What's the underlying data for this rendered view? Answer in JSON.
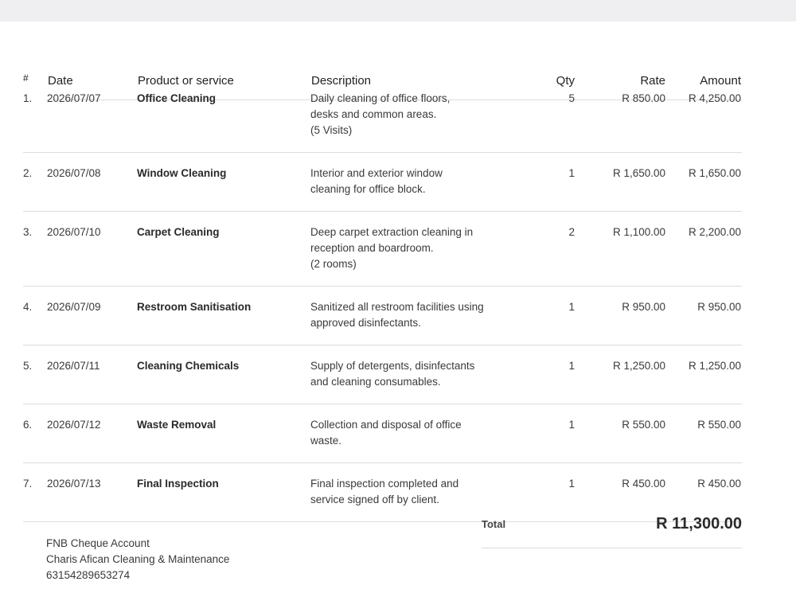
{
  "headers": {
    "number": "#",
    "date": "Date",
    "product": "Product or service",
    "description": "Description",
    "qty": "Qty",
    "rate": "Rate",
    "amount": "Amount"
  },
  "rows": [
    {
      "number": "1.",
      "date": "2026/07/07",
      "product": "Office Cleaning",
      "description": [
        "Daily cleaning of office floors,",
        "desks and common areas.",
        "(5 Visits)"
      ],
      "qty": "5",
      "rate": "R 850.00",
      "amount": "R 4,250.00"
    },
    {
      "number": "2.",
      "date": "2026/07/08",
      "product": "Window Cleaning",
      "description": [
        "Interior and exterior window",
        "cleaning for office block."
      ],
      "qty": "1",
      "rate": "R 1,650.00",
      "amount": "R 1,650.00"
    },
    {
      "number": "3.",
      "date": "2026/07/10",
      "product": "Carpet Cleaning",
      "description": [
        "Deep carpet extraction cleaning in",
        "reception and boardroom.",
        "(2 rooms)"
      ],
      "qty": "2",
      "rate": "R 1,100.00",
      "amount": "R 2,200.00"
    },
    {
      "number": "4.",
      "date": "2026/07/09",
      "product": "Restroom Sanitisation",
      "description": [
        "Sanitized all restroom facilities using",
        "approved disinfectants."
      ],
      "qty": "1",
      "rate": "R 950.00",
      "amount": "R 950.00"
    },
    {
      "number": "5.",
      "date": "2026/07/11",
      "product": "Cleaning Chemicals",
      "description": [
        "Supply of detergents, disinfectants",
        "and cleaning consumables."
      ],
      "qty": "1",
      "rate": "R 1,250.00",
      "amount": "R 1,250.00"
    },
    {
      "number": "6.",
      "date": "2026/07/12",
      "product": "Waste Removal",
      "description": [
        "Collection and disposal of office",
        "waste."
      ],
      "qty": "1",
      "rate": "R 550.00",
      "amount": "R 550.00"
    },
    {
      "number": "7.",
      "date": "2026/07/13",
      "product": "Final Inspection",
      "description": [
        "Final inspection completed and",
        "service signed off by client."
      ],
      "qty": "1",
      "rate": "R 450.00",
      "amount": "R 450.00"
    }
  ],
  "bank": {
    "account_type": "FNB Cheque Account",
    "account_name": "Charis Afican Cleaning & Maintenance",
    "account_number": "63154289653274"
  },
  "total": {
    "label": "Total",
    "value": "R 11,300.00"
  }
}
